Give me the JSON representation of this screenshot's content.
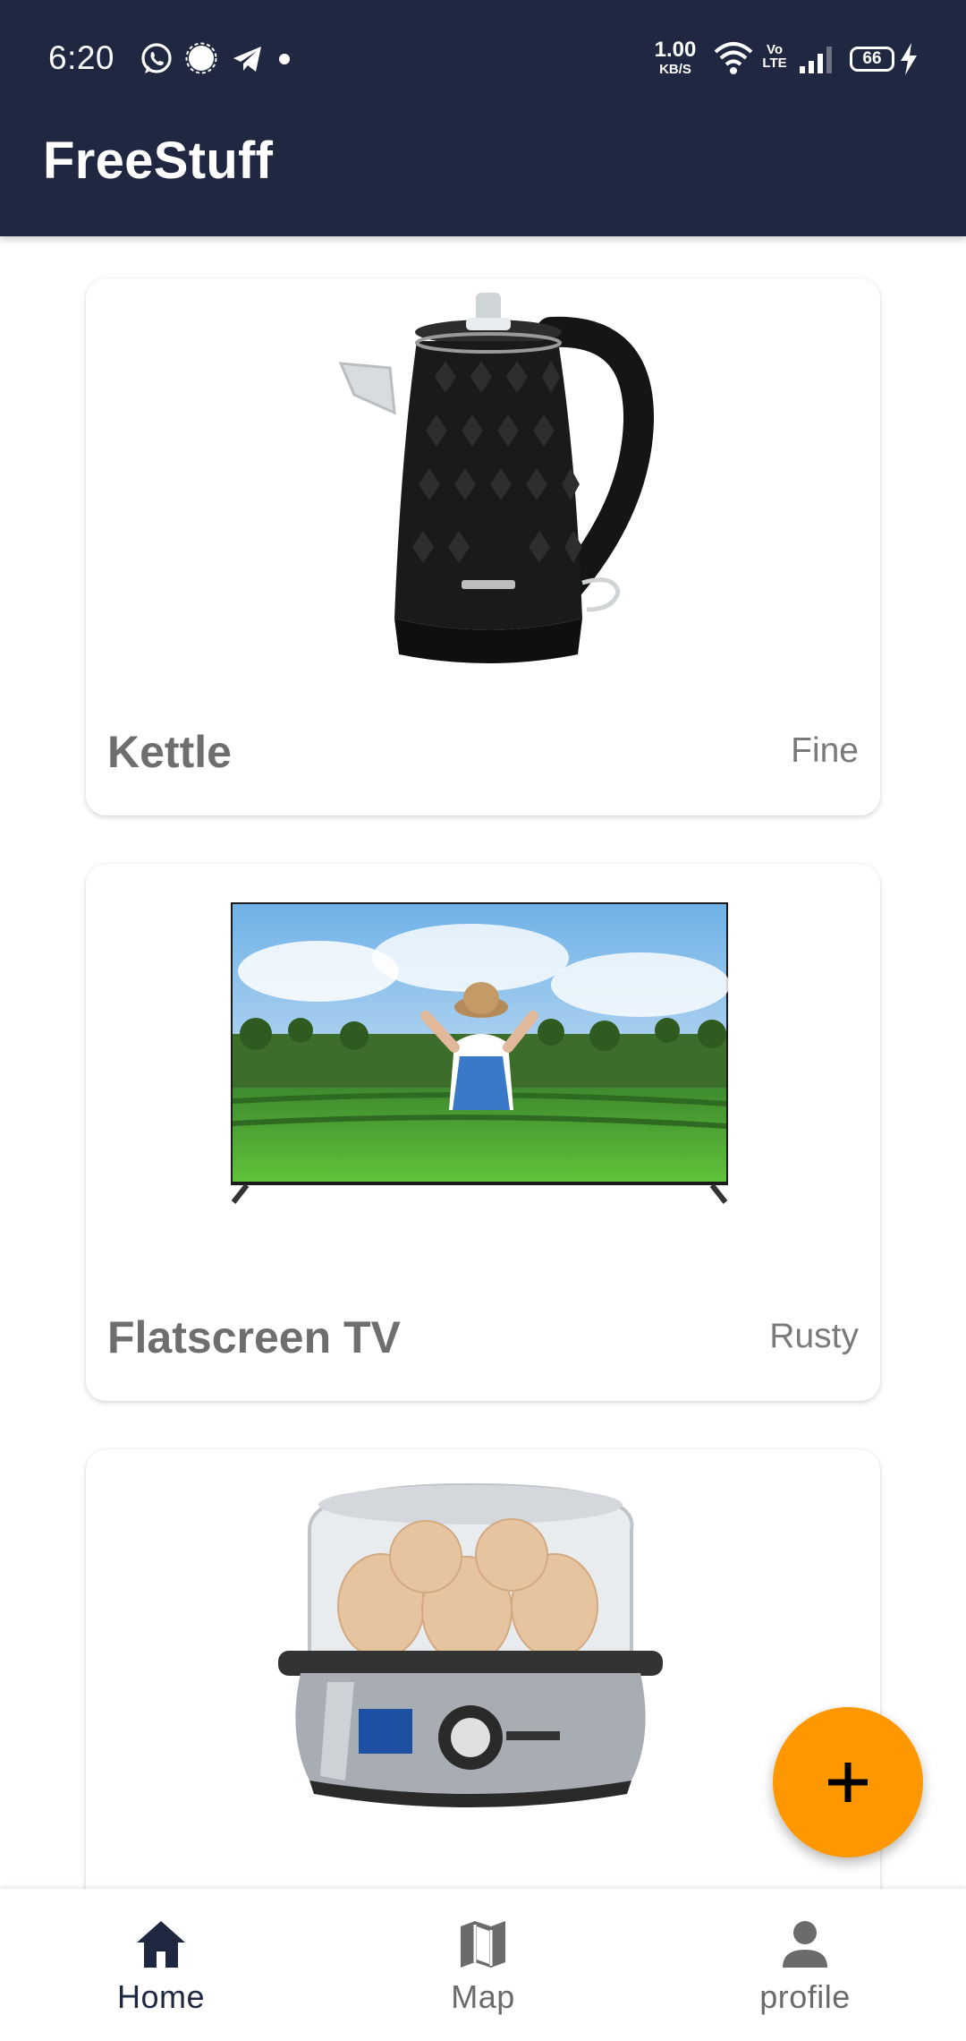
{
  "status_bar": {
    "time": "6:20",
    "net_speed_value": "1.00",
    "net_speed_unit": "KB/S",
    "volte_top": "Vo",
    "volte_bottom": "LTE",
    "battery": "66",
    "notification_icons": [
      "whatsapp-icon",
      "signal-messenger-icon",
      "telegram-icon",
      "dot-icon"
    ],
    "system_icons": [
      "wifi-icon",
      "volte-icon",
      "cell-signal-icon",
      "battery-icon",
      "charging-bolt-icon"
    ]
  },
  "app_bar": {
    "title": "FreeStuff",
    "background": "#1f2741"
  },
  "items": [
    {
      "title": "Kettle",
      "condition": "Fine",
      "image": "black-kettle"
    },
    {
      "title": "Flatscreen TV",
      "condition": "Rusty",
      "image": "flatscreen-tv-landscape"
    },
    {
      "title": "",
      "condition": "",
      "image": "egg-boiler"
    }
  ],
  "fab": {
    "icon": "plus-icon",
    "color": "#ff9800"
  },
  "bottom_nav": {
    "items": [
      {
        "label": "Home",
        "icon": "home-icon",
        "active": true
      },
      {
        "label": "Map",
        "icon": "map-icon",
        "active": false
      },
      {
        "label": "profile",
        "icon": "person-icon",
        "active": false
      }
    ]
  }
}
